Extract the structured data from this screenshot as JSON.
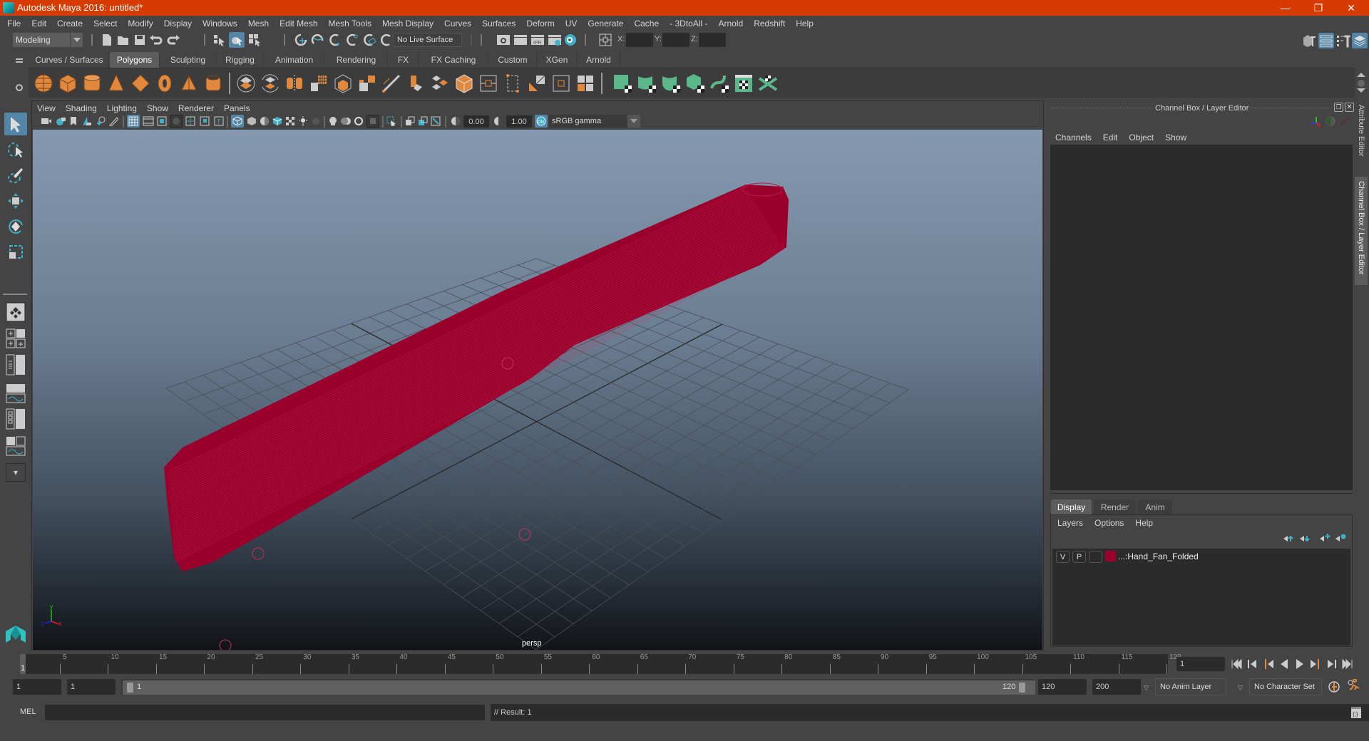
{
  "window": {
    "title": "Autodesk Maya 2016: untitled*",
    "controls": [
      "minimize",
      "restore",
      "close"
    ],
    "accent_color": "#d83b01"
  },
  "menubar": [
    "File",
    "Edit",
    "Create",
    "Select",
    "Modify",
    "Display",
    "Windows",
    "Mesh",
    "Edit Mesh",
    "Mesh Tools",
    "Mesh Display",
    "Curves",
    "Surfaces",
    "Deform",
    "UV",
    "Generate",
    "Cache",
    "- 3DtoAll -",
    "Arnold",
    "Redshift",
    "Help"
  ],
  "statusline": {
    "menuset": "Modeling",
    "live_surface": "No Live Surface",
    "x_label": "X:",
    "y_label": "Y:",
    "z_label": "Z:",
    "x_value": "",
    "y_value": "",
    "z_value": ""
  },
  "shelf": {
    "tabs": [
      "Curves / Surfaces",
      "Polygons",
      "Sculpting",
      "Rigging",
      "Animation",
      "Rendering",
      "FX",
      "FX Caching",
      "Custom",
      "XGen",
      "Arnold"
    ],
    "active_tab": "Polygons",
    "icons": [
      "poly-sphere-icon",
      "poly-cube-icon",
      "poly-cylinder-icon",
      "poly-cone-icon",
      "poly-plane-icon",
      "poly-torus-icon",
      "poly-pyramid-icon",
      "poly-pipe-icon",
      "combine-icon",
      "separate-icon",
      "mirror-icon",
      "smooth-icon",
      "extrude-icon",
      "bevel-icon",
      "bridge-icon",
      "multi-cut-icon",
      "insert-edge-loop-icon",
      "merge-icon",
      "bevel-face-icon",
      "fill-hole-icon",
      "extract-icon",
      "append-icon",
      "uv-planar-icon",
      "uv-cylindrical-icon",
      "uv-spherical-icon",
      "uv-automatic-icon",
      "uv-unfold-icon",
      "uv-editor-icon",
      "uv-layout-icon"
    ]
  },
  "viewport": {
    "menu": [
      "View",
      "Shading",
      "Lighting",
      "Show",
      "Renderer",
      "Panels"
    ],
    "exposure": "0.00",
    "gamma": "1.00",
    "color_space": "sRGB gamma",
    "camera_label": "persp",
    "object_color": "#9b002c"
  },
  "channel_box": {
    "title": "Channel Box / Layer Editor",
    "menu": [
      "Channels",
      "Edit",
      "Object",
      "Show"
    ]
  },
  "layer_editor": {
    "tabs": [
      "Display",
      "Render",
      "Anim"
    ],
    "active_tab": "Display",
    "menu": [
      "Layers",
      "Options",
      "Help"
    ],
    "layers": [
      {
        "visible": "V",
        "playback": "P",
        "type": "",
        "color": "#9b002c",
        "name": "...:Hand_Fan_Folded"
      }
    ]
  },
  "side_tabs": [
    "Attribute Editor",
    "Channel Box / Layer Editor"
  ],
  "timeline": {
    "ticks": [
      "5",
      "10",
      "15",
      "20",
      "25",
      "30",
      "35",
      "40",
      "45",
      "50",
      "55",
      "60",
      "65",
      "70",
      "75",
      "80",
      "85",
      "90",
      "95",
      "100",
      "105",
      "110",
      "115",
      "120"
    ],
    "current_frame_marker": "1",
    "current_frame": "1"
  },
  "range": {
    "start": "1",
    "playback_start": "1",
    "slider_start": "1",
    "slider_end": "120",
    "playback_end": "120",
    "end": "200",
    "anim_layer": "No Anim Layer",
    "character_set": "No Character Set"
  },
  "command_line": {
    "language": "MEL",
    "input": "",
    "result": "// Result: 1"
  }
}
